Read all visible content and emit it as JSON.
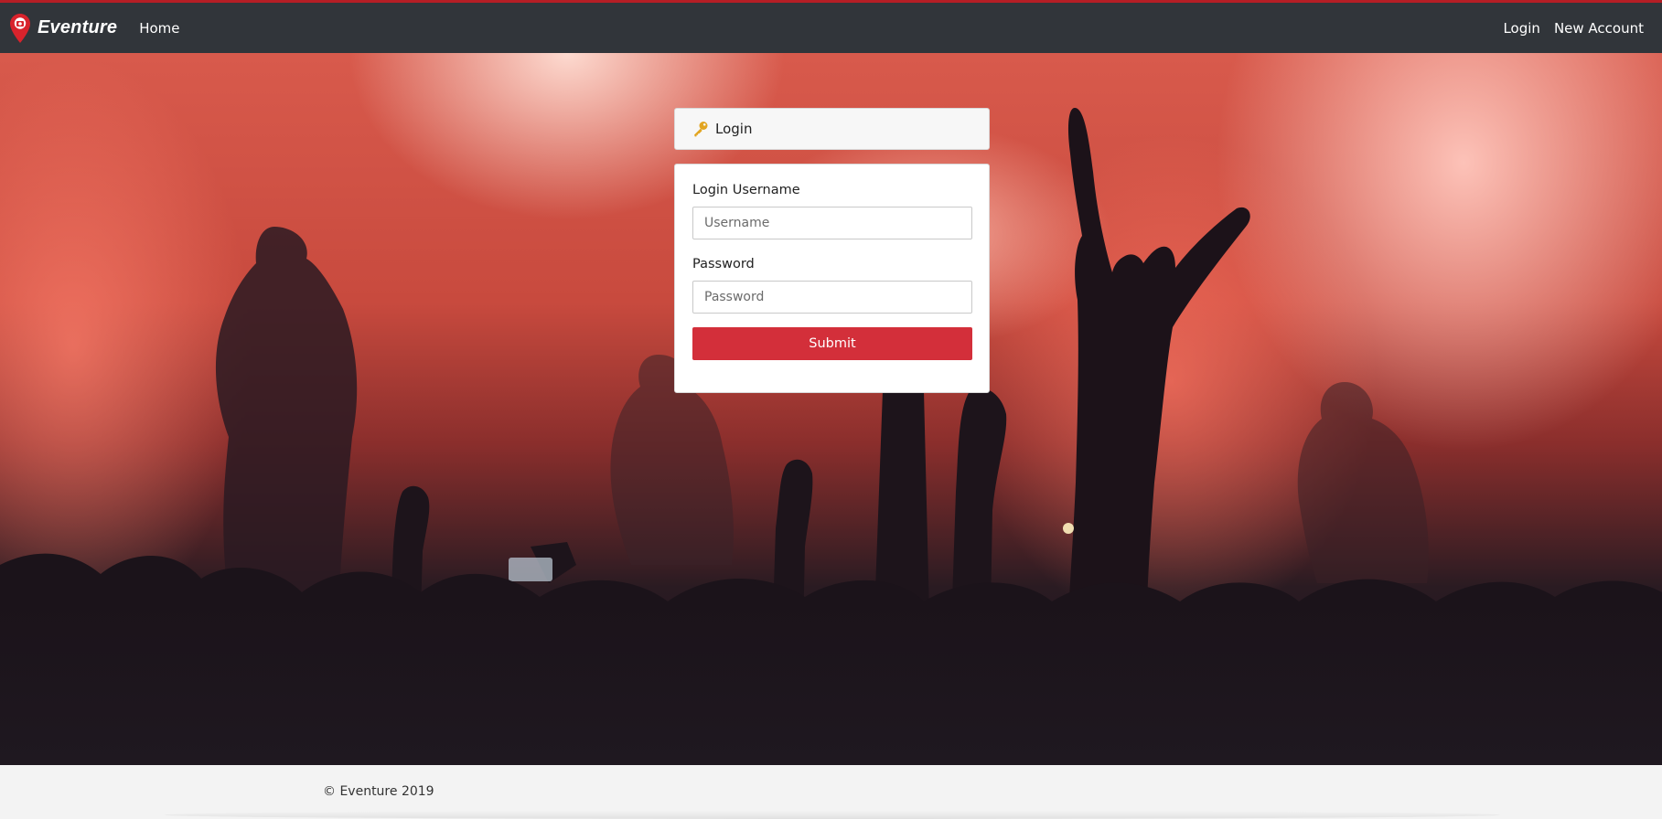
{
  "nav": {
    "brand": "Eventure",
    "home": "Home",
    "login": "Login",
    "new_account": "New Account"
  },
  "login_panel": {
    "heading": "Login",
    "username_label": "Login Username",
    "username_placeholder": "Username",
    "password_label": "Password",
    "password_placeholder": "Password",
    "submit": "Submit"
  },
  "footer": {
    "copyright": "© Eventure 2019"
  },
  "colors": {
    "navbar": "#31353a",
    "accent": "#d32f3a",
    "panel": "#ffffff"
  }
}
